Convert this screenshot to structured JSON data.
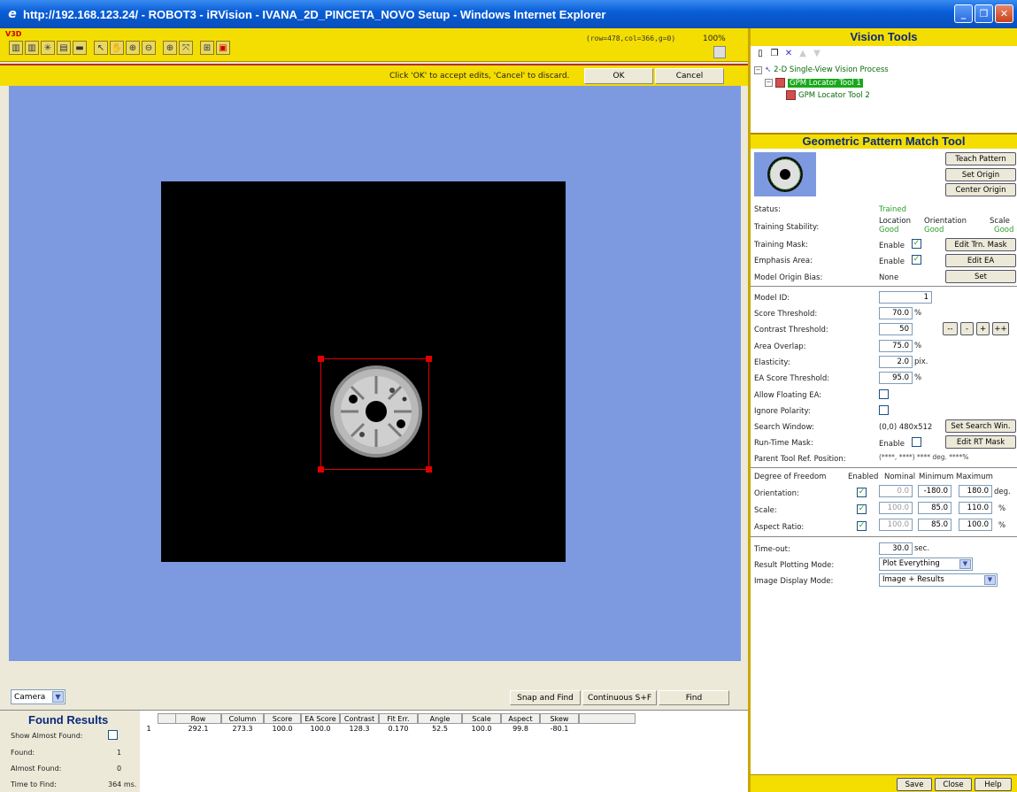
{
  "window": {
    "title": "http://192.168.123.24/ - ROBOT3 - iRVision - IVANA_2D_PINCETA_NOVO Setup - Windows Internet Explorer"
  },
  "toolbar": {
    "badge": "V3D",
    "coords": "(row=478,col=366,g=0)",
    "zoom": "100%"
  },
  "edit": {
    "message": "Click 'OK' to accept edits, 'Cancel' to discard.",
    "ok_label": "OK",
    "cancel_label": "Cancel"
  },
  "camera": {
    "selected": "Camera",
    "snap_find_label": "Snap and Find",
    "continuous_label": "Continuous S+F",
    "find_label": "Find"
  },
  "found": {
    "title": "Found Results",
    "show_almost_label": "Show Almost Found:",
    "found_label": "Found:",
    "found_value": "1",
    "almost_label": "Almost Found:",
    "almost_value": "0",
    "time_label": "Time to Find:",
    "time_value": "364 ms.",
    "columns": [
      "Row",
      "Column",
      "Score",
      "EA Score",
      "Contrast",
      "Fit Err.",
      "Angle",
      "Scale",
      "Aspect",
      "Skew"
    ],
    "row": {
      "index": "1",
      "values": [
        "292.1",
        "273.3",
        "100.0",
        "100.0",
        "128.3",
        "0.170",
        "52.5",
        "100.0",
        "99.8",
        "-80.1"
      ]
    }
  },
  "vision_tools": {
    "title": "Vision Tools",
    "tree": {
      "root": "2-D Single-View Vision Process",
      "child1": "GPM Locator Tool 1",
      "child2": "GPM Locator Tool 2"
    }
  },
  "gpm": {
    "title": "Geometric Pattern Match Tool",
    "teach_label": "Teach Pattern",
    "set_origin_label": "Set Origin",
    "center_origin_label": "Center Origin",
    "status_label": "Status:",
    "status_value": "Trained",
    "stability_label": "Training Stability:",
    "stab_location": "Location",
    "stab_orientation": "Orientation",
    "stab_scale": "Scale",
    "stab_loc_val": "Good",
    "stab_ori_val": "Good",
    "stab_scale_val": "Good",
    "mask_label": "Training Mask:",
    "enable_label": "Enable",
    "edit_trn_mask": "Edit Trn. Mask",
    "emphasis_label": "Emphasis Area:",
    "edit_ea": "Edit EA",
    "origin_bias_label": "Model Origin Bias:",
    "origin_bias_value": "None",
    "set_label": "Set",
    "model_id_label": "Model ID:",
    "model_id": "1",
    "score_th_label": "Score Threshold:",
    "score_th": "70.0",
    "pct": "%",
    "contrast_th_label": "Contrast Threshold:",
    "contrast_th": "50",
    "step_mm": "--",
    "step_m": "-",
    "step_p": "+",
    "step_pp": "++",
    "area_overlap_label": "Area Overlap:",
    "area_overlap": "75.0",
    "elasticity_label": "Elasticity:",
    "elasticity": "2.0",
    "pix": "pix.",
    "ea_score_label": "EA Score Threshold:",
    "ea_score": "95.0",
    "floating_label": "Allow Floating EA:",
    "polarity_label": "Ignore Polarity:",
    "search_win_label": "Search Window:",
    "search_win_value": "(0,0) 480x512",
    "set_search_win": "Set Search Win.",
    "rt_mask_label": "Run-Time Mask:",
    "edit_rt_mask": "Edit RT Mask",
    "parent_ref_label": "Parent Tool Ref. Position:",
    "parent_ref_value": "(****, ****)   **** deg.  ****%",
    "dof_label": "Degree of Freedom",
    "dof_enabled": "Enabled",
    "dof_nominal": "Nominal",
    "dof_min": "Minimum",
    "dof_max": "Maximum",
    "orientation_label": "Orientation:",
    "ori_nom": "0.0",
    "ori_min": "-180.0",
    "ori_max": "180.0",
    "deg": "deg.",
    "scale_label": "Scale:",
    "sc_nom": "100.0",
    "sc_min": "85.0",
    "sc_max": "110.0",
    "aspect_label": "Aspect Ratio:",
    "as_nom": "100.0",
    "as_min": "85.0",
    "as_max": "100.0",
    "timeout_label": "Time-out:",
    "timeout": "30.0",
    "sec": "sec.",
    "plot_mode_label": "Result Plotting Mode:",
    "plot_mode": "Plot Everything",
    "display_mode_label": "Image Display Mode:",
    "display_mode": "Image + Results"
  },
  "footer": {
    "save_label": "Save",
    "close_label": "Close",
    "help_label": "Help"
  }
}
